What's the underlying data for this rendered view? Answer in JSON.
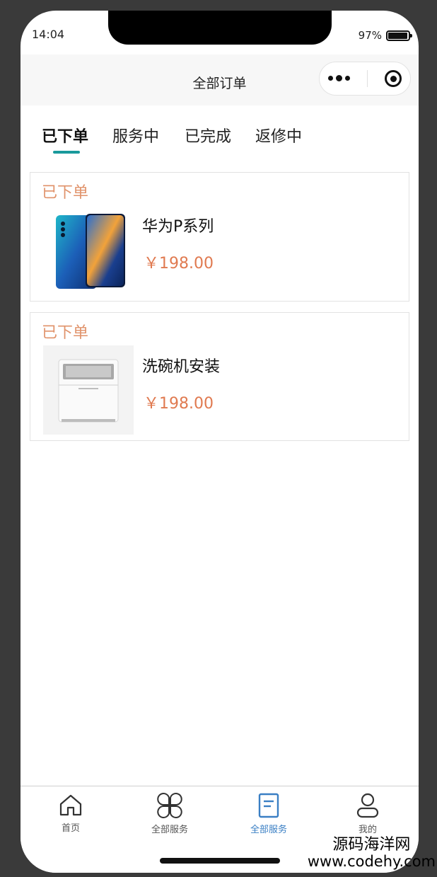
{
  "status_bar": {
    "time": "14:04",
    "battery": "97%",
    "battery_level": 0.97
  },
  "navbar": {
    "title": "全部订单",
    "more_icon": "more-dots-icon",
    "close_icon": "target-circle-icon"
  },
  "tabs": [
    {
      "label": "已下单",
      "active": true
    },
    {
      "label": "服务中",
      "active": false
    },
    {
      "label": "已完成",
      "active": false
    },
    {
      "label": "返修中",
      "active": false
    }
  ],
  "orders": [
    {
      "status": "已下单",
      "name": "华为P系列",
      "price": "￥198.00",
      "image": "phone-product-image"
    },
    {
      "status": "已下单",
      "name": "洗碗机安装",
      "price": "￥198.00",
      "image": "dishwasher-product-image"
    }
  ],
  "tabbar": [
    {
      "label": "首页",
      "icon": "home-icon",
      "active": false
    },
    {
      "label": "全部服务",
      "icon": "grid-flower-icon",
      "active": false
    },
    {
      "label": "全部服务",
      "icon": "document-icon",
      "active": true
    },
    {
      "label": "我的",
      "icon": "user-icon",
      "active": false
    }
  ],
  "watermark": {
    "line1": "源码海洋网",
    "line2": "www.codehy.com"
  },
  "colors": {
    "accent": "#1a9a9c",
    "status": "#e0926a",
    "price": "#e07a50",
    "tabbar_active": "#3a7fc4"
  }
}
